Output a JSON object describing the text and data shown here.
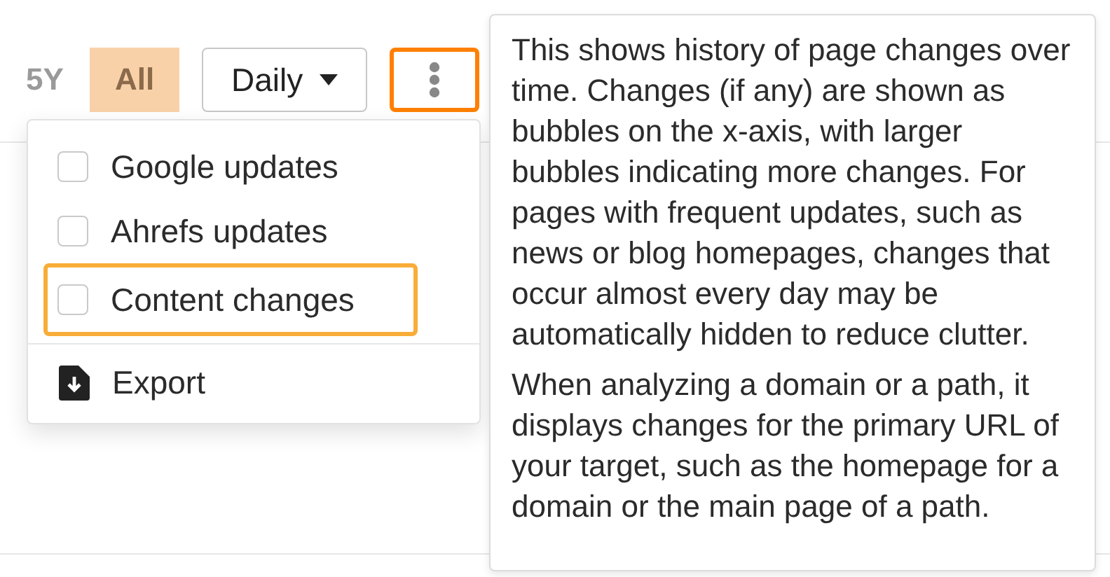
{
  "period_buttons": [
    {
      "label": "5Y",
      "selected": false
    },
    {
      "label": "All",
      "selected": true
    }
  ],
  "interval_dropdown": {
    "value": "Daily"
  },
  "more_button": {
    "highlighted": true
  },
  "menu": {
    "items": [
      {
        "kind": "checkbox",
        "label": "Google updates",
        "checked": false,
        "highlighted": false
      },
      {
        "kind": "checkbox",
        "label": "Ahrefs updates",
        "checked": false,
        "highlighted": false
      },
      {
        "kind": "checkbox",
        "label": "Content changes",
        "checked": false,
        "highlighted": true
      },
      {
        "kind": "divider"
      },
      {
        "kind": "action",
        "label": "Export",
        "highlighted": false
      }
    ]
  },
  "tooltip": {
    "paragraphs": [
      "This shows history of page changes over time. Changes (if any) are shown as bubbles on the x-axis, with larger bubbles indicating more changes. For pages with frequent updates, such as news or blog homepages, changes that occur almost every day may be automatically hidden to reduce clutter.",
      "When analyzing a domain or a path, it displays changes for the primary URL of your target, such as the homepage for a domain or the main page of a path."
    ]
  }
}
